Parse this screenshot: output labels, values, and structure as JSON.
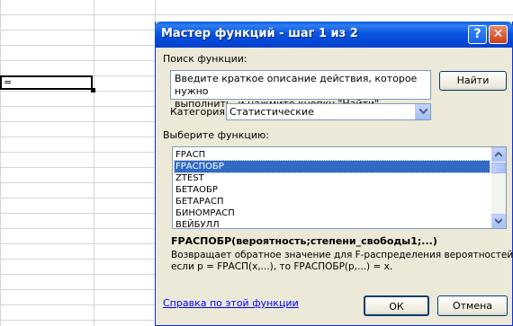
{
  "spreadsheet": {
    "active_cell_value": "="
  },
  "dialog": {
    "title": "Мастер функций - шаг 1 из 2",
    "help_button": "?",
    "close_button": "✕",
    "search_label": "Поиск функции:",
    "search_value": "Введите краткое описание действия, которое нужно выполнить, и нажмите кнопку \"Найти\"",
    "search_value_line1": "Введите краткое описание действия, которое нужно",
    "search_value_line2": "выполнить, и нажмите кнопку \"Найти\"",
    "find_button": "Найти",
    "category_label": "Категория:",
    "category_value": "Статистические",
    "function_list_label": "Выберите функцию:",
    "functions": [
      "FРАСП",
      "FРАСПОБР",
      "ZTEST",
      "БЕТАОБР",
      "БЕТАРАСП",
      "БИНОМРАСП",
      "ВЕЙБУЛЛ"
    ],
    "selected_index": 1,
    "signature": "FРАСПОБР(вероятность;степени_свободы1;...)",
    "description_line1": "Возвращает обратное значение для F-распределения вероятностей:",
    "description_line2": "если p = FРАСП(x,...), то FРАСПОБР(p,...) = x.",
    "help_link": "Справка по этой функции",
    "ok_button": "ОК",
    "cancel_button": "Отмена"
  }
}
